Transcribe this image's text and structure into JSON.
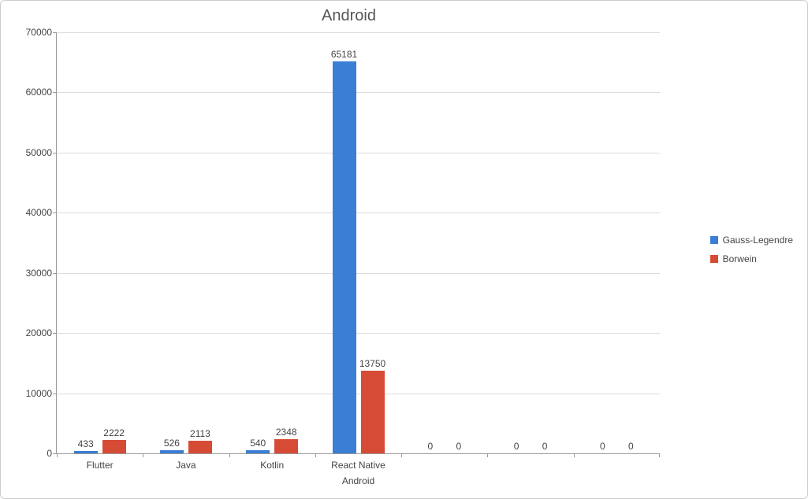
{
  "chart_data": {
    "type": "bar",
    "title": "Android",
    "xlabel": "Android",
    "ylabel": "",
    "ylim": [
      0,
      70000
    ],
    "y_ticks": [
      0,
      10000,
      20000,
      30000,
      40000,
      50000,
      60000,
      70000
    ],
    "categories": [
      "Flutter",
      "Java",
      "Kotlin",
      "React Native",
      "",
      "",
      ""
    ],
    "series": [
      {
        "name": "Gauss-Legendre",
        "color": "#3b7ed6",
        "values": [
          433,
          526,
          540,
          65181,
          0,
          0,
          0
        ]
      },
      {
        "name": "Borwein",
        "color": "#d64b35",
        "values": [
          2222,
          2113,
          2348,
          13750,
          0,
          0,
          0
        ]
      }
    ],
    "legend_position": "right",
    "grid": true
  }
}
